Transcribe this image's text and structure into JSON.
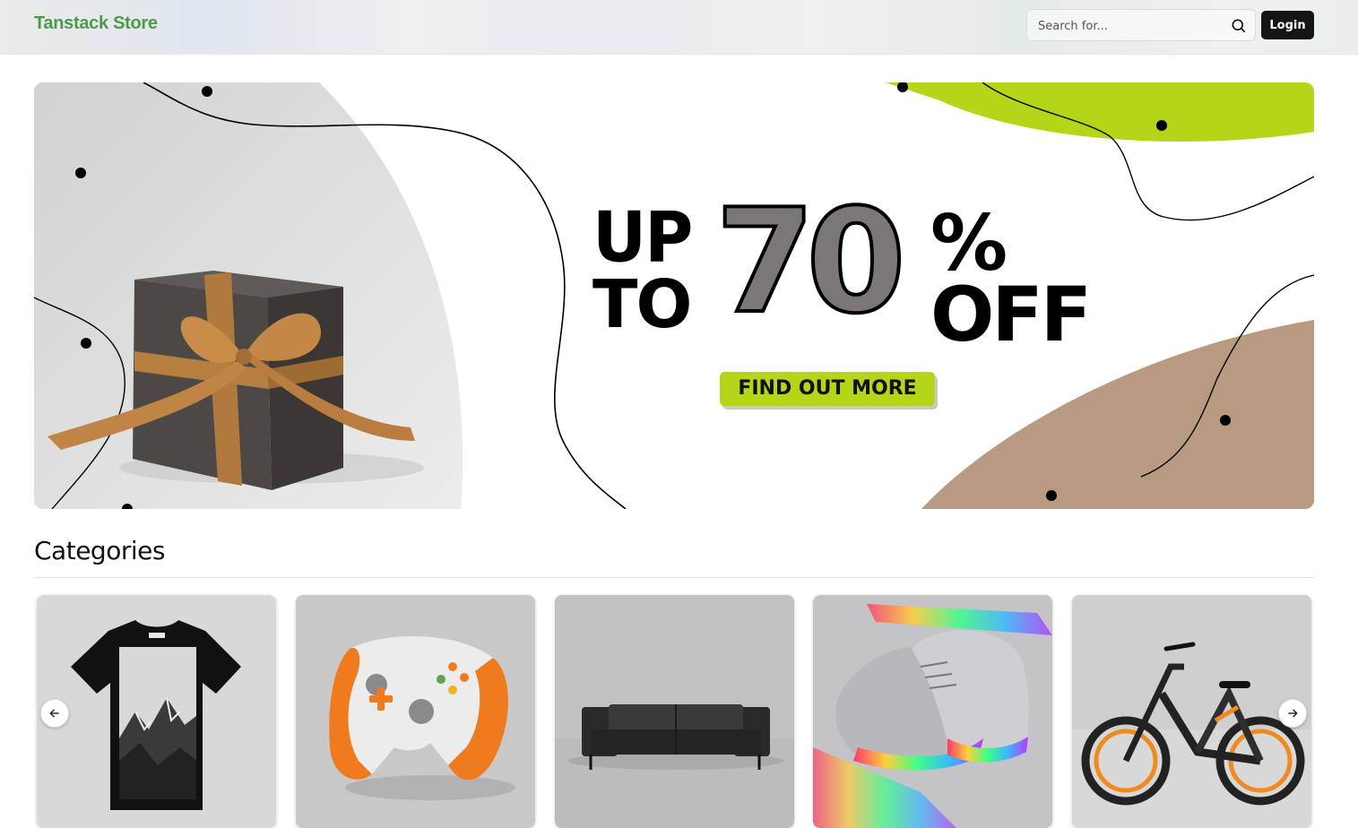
{
  "header": {
    "brand": "Tanstack Store",
    "search_placeholder": "Search for...",
    "login_label": "Login"
  },
  "hero": {
    "line_up": "UP",
    "line_to": "TO",
    "discount_number": "70",
    "percent_sign": "%",
    "line_off": "OFF",
    "cta_label": "FIND OUT MORE",
    "colors": {
      "lime": "#b5d519",
      "tan": "#b79a80",
      "gray_arc": "#dcdcdc"
    }
  },
  "categories": {
    "title": "Categories",
    "items": [
      {
        "image": "t-shirt-mountain-print"
      },
      {
        "image": "white-orange-game-controller"
      },
      {
        "image": "black-leather-sofa"
      },
      {
        "image": "iridescent-soccer-cleats"
      },
      {
        "image": "black-orange-electric-bike"
      }
    ]
  },
  "carousel": {
    "prev_icon": "arrow-left-icon",
    "next_icon": "arrow-right-icon"
  }
}
